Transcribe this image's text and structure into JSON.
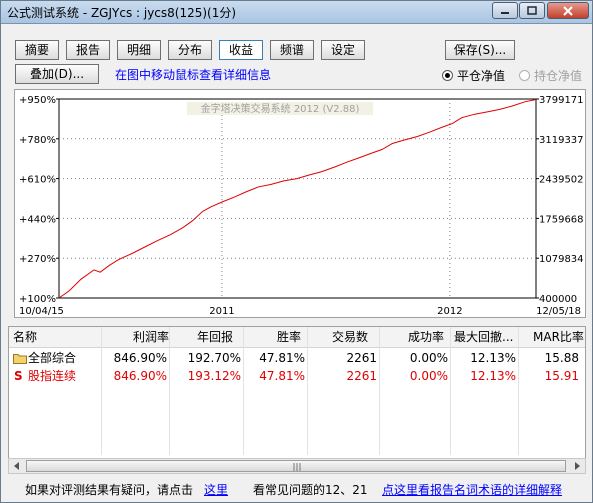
{
  "window": {
    "title": "公式测试系统 - ZGJYcs : jycs8(125)(1分)"
  },
  "toolbar": {
    "tabs": [
      {
        "label": "摘要"
      },
      {
        "label": "报告"
      },
      {
        "label": "明细"
      },
      {
        "label": "分布"
      },
      {
        "label": "收益",
        "active": true
      },
      {
        "label": "频谱"
      },
      {
        "label": "设定"
      }
    ],
    "save_label": "保存(S)...",
    "overlay_label": "叠加(D)...",
    "hint_text": "在图中移动鼠标查看详细信息",
    "radio_close": "平仓净值",
    "radio_hold": "持仓净值"
  },
  "chart_data": {
    "type": "line",
    "title": "金字塔决策交易系统 2012 (V2.88)",
    "left_ticks": [
      "+950%",
      "+780%",
      "+610%",
      "+440%",
      "+270%",
      "+100%"
    ],
    "right_ticks": [
      "3799171",
      "3119337",
      "2439502",
      "1759668",
      "1079834",
      "400000"
    ],
    "x_labels": [
      "10/04/15",
      "2011",
      "2012",
      "12/05/18"
    ],
    "ylim": [
      100,
      950
    ],
    "series": [
      {
        "color": "#e00000",
        "x": [
          "2010-04-15",
          "2010-05-01",
          "2010-05-20",
          "2010-06-10",
          "2010-06-20",
          "2010-07-05",
          "2010-07-20",
          "2010-08-10",
          "2010-09-01",
          "2010-09-20",
          "2010-10-10",
          "2010-10-30",
          "2010-11-15",
          "2010-12-01",
          "2010-12-15",
          "2011-01-01",
          "2011-01-20",
          "2011-02-10",
          "2011-03-01",
          "2011-03-20",
          "2011-04-10",
          "2011-05-01",
          "2011-05-20",
          "2011-06-10",
          "2011-07-01",
          "2011-07-20",
          "2011-08-10",
          "2011-08-25",
          "2011-09-15",
          "2011-10-01",
          "2011-10-20",
          "2011-11-10",
          "2011-12-01",
          "2011-12-20",
          "2012-01-05",
          "2012-01-20",
          "2012-02-10",
          "2012-03-01",
          "2012-03-20",
          "2012-04-10",
          "2012-04-30",
          "2012-05-18"
        ],
        "y": [
          100,
          130,
          180,
          220,
          210,
          240,
          265,
          290,
          320,
          345,
          370,
          400,
          430,
          470,
          490,
          510,
          530,
          555,
          575,
          585,
          600,
          610,
          625,
          640,
          660,
          680,
          700,
          715,
          735,
          760,
          775,
          790,
          810,
          830,
          845,
          870,
          885,
          895,
          905,
          920,
          938,
          948
        ]
      }
    ]
  },
  "grid": {
    "columns": [
      "名称",
      "利润率",
      "年回报",
      "胜率",
      "交易数",
      "成功率",
      "最大回撤...",
      "MAR比率"
    ],
    "rows": [
      {
        "icon": "folder-icon",
        "name": "全部综合",
        "profit": "846.90%",
        "annual": "192.70%",
        "win": "47.81%",
        "trades": "2261",
        "success": "0.00%",
        "drawdown": "12.13%",
        "mar": "15.88",
        "color": "#000000"
      },
      {
        "icon": "s-icon",
        "icon_text": "S",
        "name": "股指连续",
        "profit": "846.90%",
        "annual": "193.12%",
        "win": "47.81%",
        "trades": "2261",
        "success": "0.00%",
        "drawdown": "12.13%",
        "mar": "15.91",
        "color": "#e00000"
      }
    ]
  },
  "statusbar": {
    "prefix": "如果对评测结果有疑问，请点击",
    "here_link": "这里",
    "faq_text": "看常见问题的12、21",
    "report_link": "点这里看报告名词术语的详细解释"
  }
}
